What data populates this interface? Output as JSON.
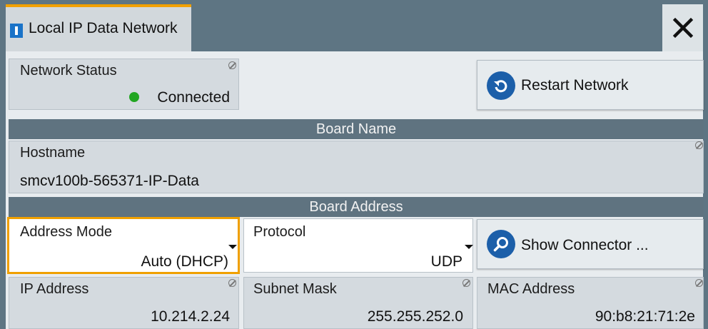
{
  "window": {
    "tab_title": "Local IP Data Network"
  },
  "network_status": {
    "label": "Network Status",
    "value": "Connected",
    "status_color": "#22a622"
  },
  "restart_button": {
    "label": "Restart Network"
  },
  "board_name": {
    "header": "Board Name",
    "hostname_label": "Hostname",
    "hostname_value": "smcv100b-565371-IP-Data"
  },
  "board_address": {
    "header": "Board Address",
    "address_mode": {
      "label": "Address Mode",
      "value": "Auto (DHCP)"
    },
    "protocol": {
      "label": "Protocol",
      "value": "UDP"
    },
    "show_connector_label": "Show Connector ...",
    "ip_address": {
      "label": "IP Address",
      "value": "10.214.2.24"
    },
    "subnet_mask": {
      "label": "Subnet Mask",
      "value": "255.255.252.0"
    },
    "mac_address": {
      "label": "MAC Address",
      "value": "90:b8:21:71:2e"
    }
  },
  "colors": {
    "accent": "#f0a000",
    "header_bg": "#5f7380",
    "button_icon": "#1c5fa9"
  }
}
